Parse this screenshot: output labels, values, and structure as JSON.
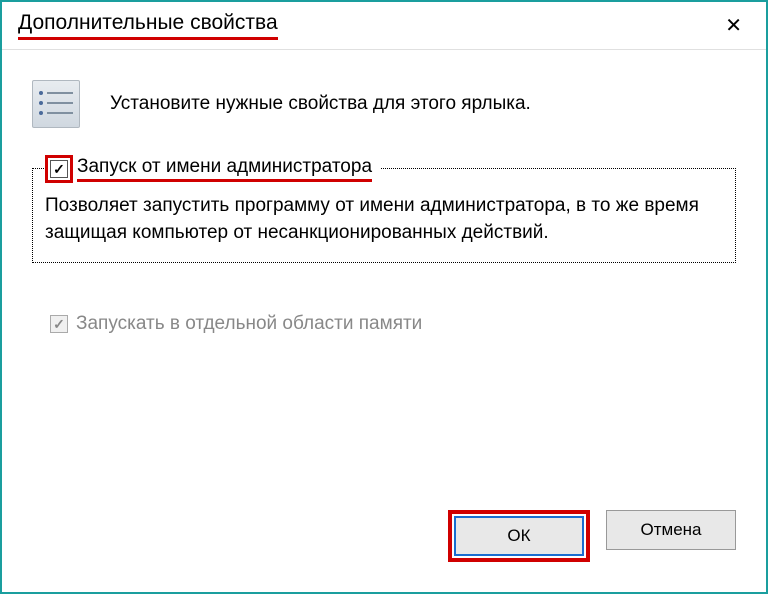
{
  "titlebar": {
    "title": "Дополнительные свойства"
  },
  "header": {
    "instruction": "Установите нужные свойства для этого ярлыка."
  },
  "runAsAdmin": {
    "label": "Запуск от имени администратора",
    "description": "Позволяет запустить программу от имени администратора, в то же время защищая компьютер от несанкционированных действий.",
    "checked": true
  },
  "separateMemory": {
    "label": "Запускать в отдельной области памяти",
    "checked": true,
    "disabled": true
  },
  "buttons": {
    "ok": "ОК",
    "cancel": "Отмена"
  }
}
